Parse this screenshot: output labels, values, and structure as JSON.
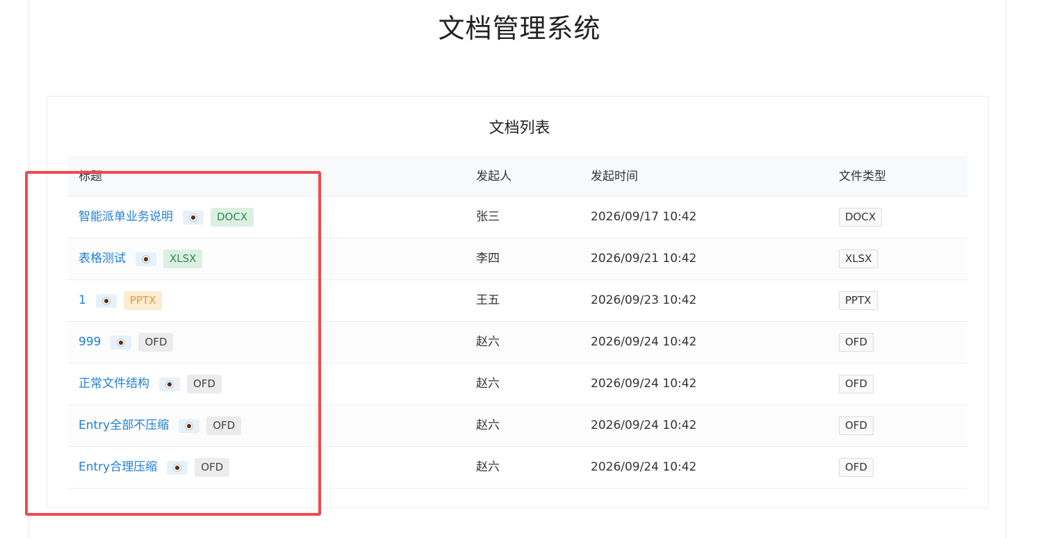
{
  "page_title": "文档管理系统",
  "card_title": "文档列表",
  "columns": {
    "title": "标题",
    "creator": "发起人",
    "time": "发起时间",
    "type": "文件类型"
  },
  "rows": [
    {
      "title": "智能派单业务说明",
      "badge": "DOCX",
      "creator": "张三",
      "time": "2026/09/17 10:42",
      "type": "DOCX"
    },
    {
      "title": "表格测试",
      "badge": "XLSX",
      "creator": "李四",
      "time": "2026/09/21 10:42",
      "type": "XLSX"
    },
    {
      "title": "1",
      "badge": "PPTX",
      "creator": "王五",
      "time": "2026/09/23 10:42",
      "type": "PPTX"
    },
    {
      "title": "999",
      "badge": "OFD",
      "creator": "赵六",
      "time": "2026/09/24 10:42",
      "type": "OFD"
    },
    {
      "title": "正常文件结构",
      "badge": "OFD",
      "creator": "赵六",
      "time": "2026/09/24 10:42",
      "type": "OFD"
    },
    {
      "title": "Entry全部不压缩",
      "badge": "OFD",
      "creator": "赵六",
      "time": "2026/09/24 10:42",
      "type": "OFD"
    },
    {
      "title": "Entry合理压缩",
      "badge": "OFD",
      "creator": "赵六",
      "time": "2026/09/24 10:42",
      "type": "OFD"
    }
  ],
  "icons": {
    "preview": "eye-icon"
  },
  "colors": {
    "link": "#1f7fd6",
    "highlight": "#f0494e",
    "docx": "#2f8a52",
    "pptx": "#e49a3a"
  }
}
